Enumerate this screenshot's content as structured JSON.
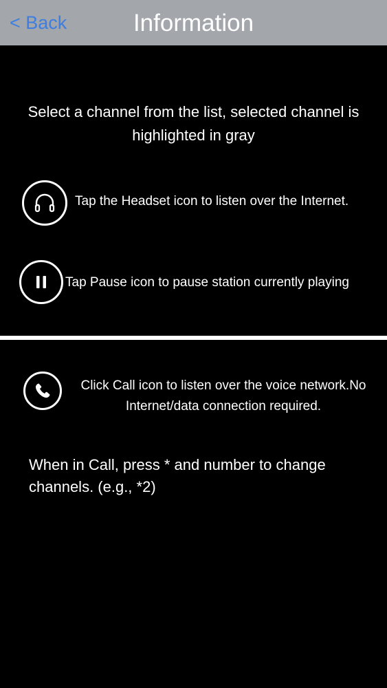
{
  "navbar": {
    "back_label": "< Back",
    "title": "Information",
    "background": "#a3a6ab",
    "back_color": "#3d7ee0"
  },
  "intro": {
    "text": "Select a channel from the list, selected channel is highlighted in gray"
  },
  "headset": {
    "icon": "headset-icon",
    "text": "Tap the Headset icon to listen over the Internet."
  },
  "pause": {
    "icon": "pause-icon",
    "text": "Tap Pause icon to pause station currently playing"
  },
  "call": {
    "icon": "phone-icon",
    "text": "Click Call icon to listen over the voice network.No Internet/data connection required."
  },
  "call_note": {
    "text": "When in Call, press * and number to change channels. (e.g., *2)"
  }
}
